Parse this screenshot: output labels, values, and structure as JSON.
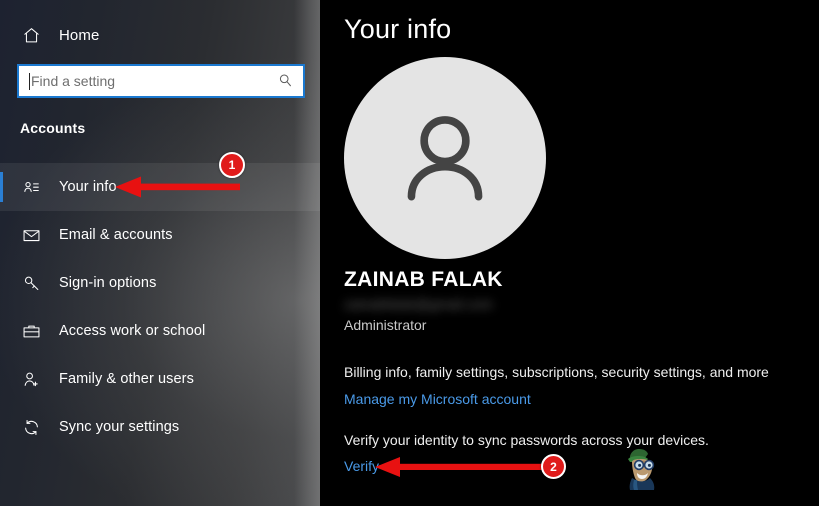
{
  "sidebar": {
    "home": {
      "label": "Home",
      "icon": "home-icon"
    },
    "search": {
      "placeholder": "Find a setting",
      "value": "",
      "icon": "search-icon"
    },
    "group_title": "Accounts",
    "items": [
      {
        "label": "Your info",
        "icon": "contact-card-icon",
        "selected": true
      },
      {
        "label": "Email & accounts",
        "icon": "envelope-icon",
        "selected": false
      },
      {
        "label": "Sign-in options",
        "icon": "key-icon",
        "selected": false
      },
      {
        "label": "Access work or school",
        "icon": "briefcase-icon",
        "selected": false
      },
      {
        "label": "Family & other users",
        "icon": "person-add-icon",
        "selected": false
      },
      {
        "label": "Sync your settings",
        "icon": "sync-icon",
        "selected": false
      }
    ]
  },
  "main": {
    "title": "Your info",
    "avatar_icon": "person-avatar-icon",
    "user_name": "ZAINAB FALAK",
    "user_email": "zainabfalak@gmail.com",
    "user_role": "Administrator",
    "billing_text": "Billing info, family settings, subscriptions, security settings, and more",
    "manage_link": "Manage my Microsoft account",
    "verify_text": "Verify your identity to sync passwords across your devices.",
    "verify_link": "Verify",
    "watermark_icon": "cartoon-mascot-watermark"
  },
  "annotations": [
    {
      "number": "1",
      "target": "Your info"
    },
    {
      "number": "2",
      "target": "Verify"
    }
  ],
  "colors": {
    "accent_blue": "#2a7fd4",
    "link_blue": "#4a9ae8",
    "annotation_red": "#e01b1b",
    "search_border": "#1b79d0",
    "avatar_bg": "#e4e4e4"
  }
}
